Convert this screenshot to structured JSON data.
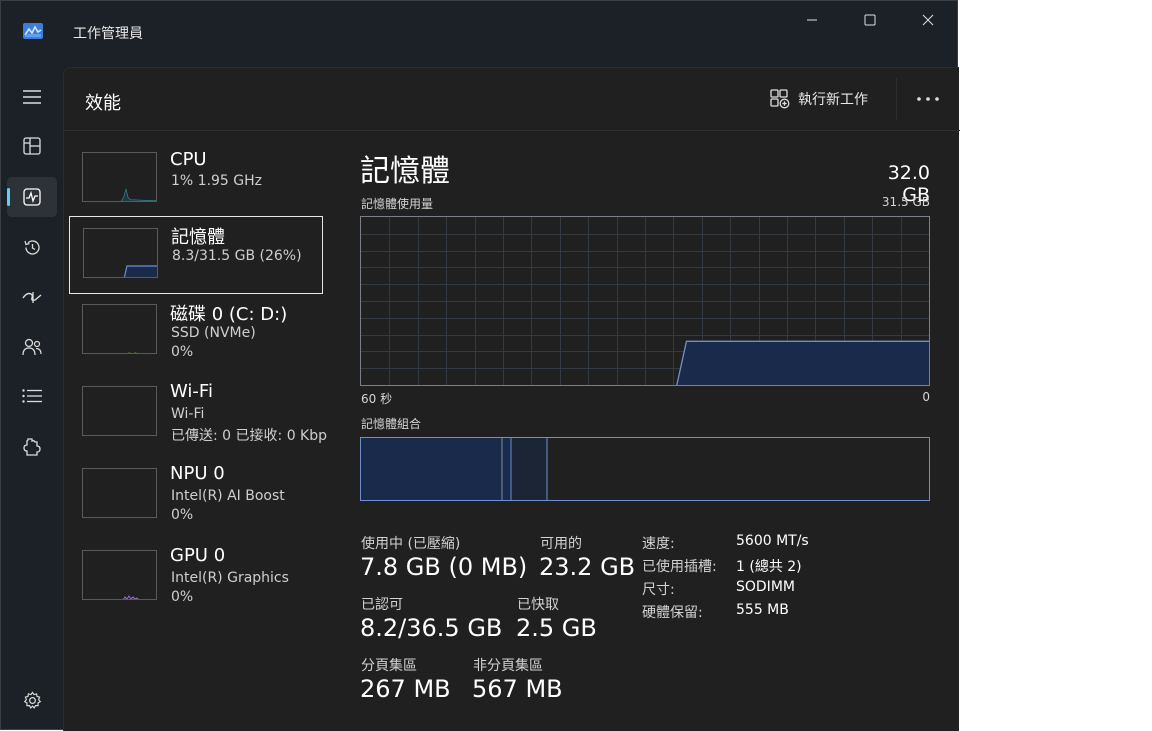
{
  "window": {
    "title": "工作管理員"
  },
  "icons": {
    "app": "task-manager-icon",
    "minimize": "minimize-icon",
    "maximize": "maximize-icon",
    "close": "close-icon",
    "menu": "hamburger-icon",
    "processes": "processes-icon",
    "performance": "performance-icon",
    "app_history": "history-icon",
    "startup": "startup-icon",
    "users": "users-icon",
    "details": "details-list-icon",
    "services": "services-icon",
    "settings": "gear-icon",
    "run_task": "new-task-icon",
    "more": "more-icon"
  },
  "colors": {
    "accent": "#60cdff",
    "memory_line": "#6e8fcf",
    "memory_fill": "#1a2a4a",
    "cpu_line": "#3aa6b9",
    "disk_line": "#6fbf3f",
    "gpu_line": "#9b6fd0"
  },
  "header": {
    "title": "效能",
    "run_task_label": "執行新工作"
  },
  "resources": [
    {
      "name": "CPU",
      "line1": "1% 1.95 GHz",
      "line2": ""
    },
    {
      "name": "記憶體",
      "line1": "8.3/31.5 GB (26%)",
      "line2": ""
    },
    {
      "name": "磁碟 0 (C: D:)",
      "line1": "SSD (NVMe)",
      "line2": "0%"
    },
    {
      "name": "Wi-Fi",
      "line1": "Wi-Fi",
      "line2": "已傳送: 0 已接收: 0 Kbps"
    },
    {
      "name": "NPU 0",
      "line1": "Intel(R) AI Boost",
      "line2": "0%"
    },
    {
      "name": "GPU 0",
      "line1": "Intel(R) Graphics",
      "line2": "0%"
    }
  ],
  "detail": {
    "title": "記憶體",
    "total": "32.0 GB",
    "usage_label": "記憶體使用量",
    "usage_max": "31.5 GB",
    "time_left": "60 秒",
    "time_right": "0",
    "composition_label": "記憶體組合",
    "usage_history_fraction": 0.26,
    "stats": {
      "in_use_label": "使用中 (已壓縮)",
      "in_use_value": "7.8 GB (0 MB)",
      "available_label": "可用的",
      "available_value": "23.2 GB",
      "committed_label": "已認可",
      "committed_value": "8.2/36.5 GB",
      "cached_label": "已快取",
      "cached_value": "2.5 GB",
      "paged_label": "分頁集區",
      "paged_value": "267 MB",
      "nonpaged_label": "非分頁集區",
      "nonpaged_value": "567 MB"
    },
    "specs": [
      {
        "key": "速度:",
        "value": "5600 MT/s"
      },
      {
        "key": "已使用插槽:",
        "value": "1 (總共 2)"
      },
      {
        "key": "尺寸:",
        "value": "SODIMM"
      },
      {
        "key": "硬體保留:",
        "value": "555 MB"
      }
    ]
  }
}
